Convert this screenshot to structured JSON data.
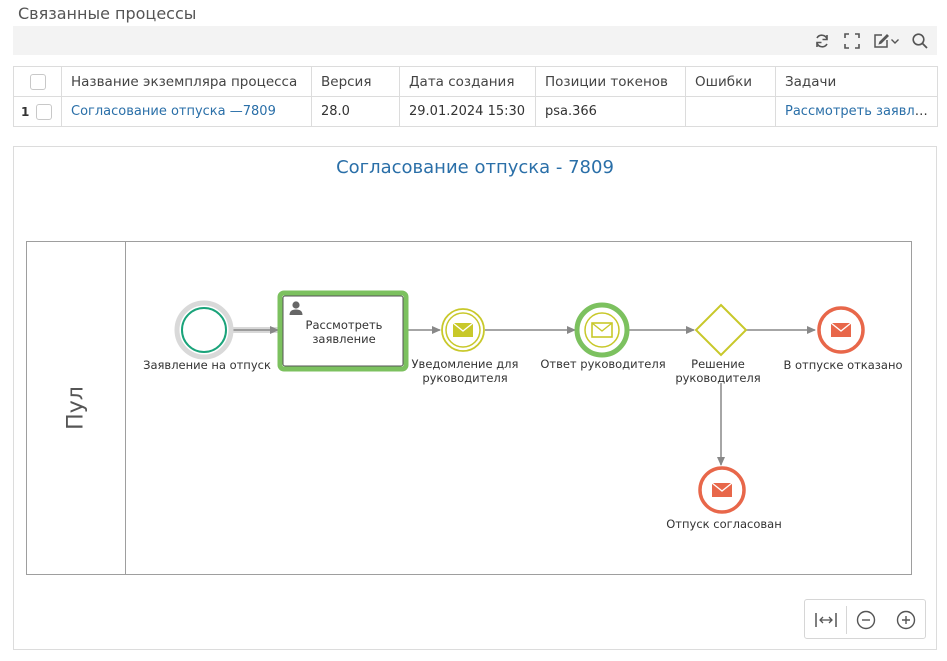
{
  "section_title": "Связанные процессы",
  "toolbar": {
    "icons": [
      "refresh-icon",
      "fullscreen-icon",
      "edit-icon",
      "chevron-down-icon",
      "search-icon"
    ]
  },
  "table": {
    "columns": [
      "Название экземпляра процесса",
      "Версия",
      "Дата создания",
      "Позиции токенов",
      "Ошибки",
      "Задачи"
    ],
    "rows": [
      {
        "number": "1",
        "name": "Согласование отпуска —7809",
        "version": "28.0",
        "created": "29.01.2024 15:30",
        "tokens": "psa.366",
        "errors": "",
        "tasks": "Рассмотреть заявление"
      }
    ]
  },
  "diagram": {
    "title": "Согласование отпуска - 7809",
    "pool_label": "Пул",
    "nodes": {
      "start": "Заявление на отпуск",
      "task_line1": "Рассмотреть",
      "task_line2": "заявление",
      "notify_line1": "Уведомление для",
      "notify_line2": "руководителя",
      "answer": "Ответ руководителя",
      "gateway_line1": "Решение",
      "gateway_line2": "руководителя",
      "rejected": "В отпуске отказано",
      "approved": "Отпуск согласован"
    },
    "colors": {
      "start_event": "#1aa37a",
      "active_green": "#7cc15f",
      "message_yellow": "#c8c82a",
      "end_event": "#e8674a",
      "link": "#2a6fa8"
    }
  },
  "zoom": {
    "icons": [
      "fit-width-icon",
      "zoom-out-icon",
      "zoom-in-icon"
    ]
  }
}
